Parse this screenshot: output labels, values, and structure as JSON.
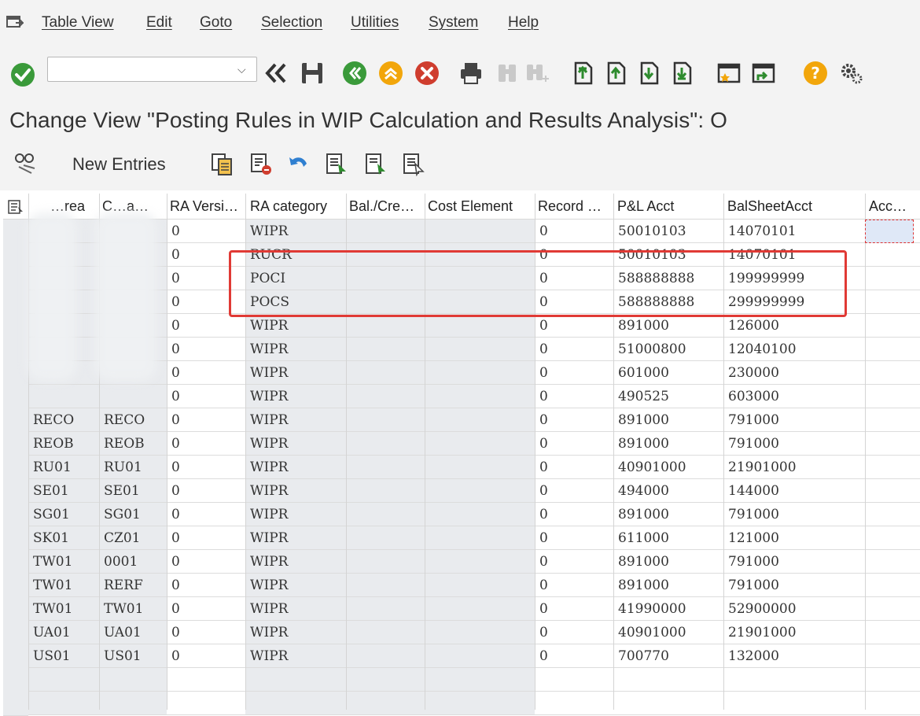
{
  "menu": {
    "items": [
      "Table View",
      "Edit",
      "Goto",
      "Selection",
      "Utilities",
      "System",
      "Help"
    ]
  },
  "toolbar": {
    "command_value": "",
    "icons": [
      "enter-icon",
      "back-double-icon",
      "save-icon",
      "back-icon",
      "exit-icon",
      "cancel-icon",
      "print-icon",
      "find-icon",
      "find-next-icon",
      "first-page-icon",
      "prev-page-icon",
      "next-page-icon",
      "last-page-icon",
      "create-session-icon",
      "shortcut-icon",
      "help-icon",
      "settings-icon"
    ]
  },
  "title": "Change View \"Posting Rules in WIP Calculation and Results Analysis\": O",
  "app_toolbar": {
    "new_entries_label": "New Entries",
    "icons": [
      "details-icon",
      "copy-icon",
      "delete-icon",
      "undo-icon",
      "select-all-icon",
      "select-block-icon",
      "deselect-all-icon"
    ]
  },
  "table": {
    "headers": [
      "",
      "…rea",
      "C…a…",
      "RA Versi…",
      "RA category",
      "Bal./Cre…",
      "Cost Element",
      "Record …",
      "P&L Acct",
      "BalSheetAcct",
      "Acc…"
    ],
    "rows": [
      [
        "",
        "",
        "0",
        "WIPR",
        "",
        "",
        "0",
        "50010103",
        "14070101"
      ],
      [
        "",
        "",
        "0",
        "RUCR",
        "",
        "",
        "0",
        "50010103",
        "14070101"
      ],
      [
        "",
        "",
        "0",
        "POCI",
        "",
        "",
        "0",
        "588888888",
        "199999999"
      ],
      [
        "",
        "",
        "0",
        "POCS",
        "",
        "",
        "0",
        "588888888",
        "299999999"
      ],
      [
        "",
        "",
        "0",
        "WIPR",
        "",
        "",
        "0",
        "891000",
        "126000"
      ],
      [
        "",
        "",
        "0",
        "WIPR",
        "",
        "",
        "0",
        "51000800",
        "12040100"
      ],
      [
        "",
        "",
        "0",
        "WIPR",
        "",
        "",
        "0",
        "601000",
        "230000"
      ],
      [
        "",
        "",
        "0",
        "WIPR",
        "",
        "",
        "0",
        "490525",
        "603000"
      ],
      [
        "RECO",
        "RECO",
        "0",
        "WIPR",
        "",
        "",
        "0",
        "891000",
        "791000"
      ],
      [
        "REOB",
        "REOB",
        "0",
        "WIPR",
        "",
        "",
        "0",
        "891000",
        "791000"
      ],
      [
        "RU01",
        "RU01",
        "0",
        "WIPR",
        "",
        "",
        "0",
        "40901000",
        "21901000"
      ],
      [
        "SE01",
        "SE01",
        "0",
        "WIPR",
        "",
        "",
        "0",
        "494000",
        "144000"
      ],
      [
        "SG01",
        "SG01",
        "0",
        "WIPR",
        "",
        "",
        "0",
        "891000",
        "791000"
      ],
      [
        "SK01",
        "CZ01",
        "0",
        "WIPR",
        "",
        "",
        "0",
        "611000",
        "121000"
      ],
      [
        "TW01",
        "0001",
        "0",
        "WIPR",
        "",
        "",
        "0",
        "891000",
        "791000"
      ],
      [
        "TW01",
        "RERF",
        "0",
        "WIPR",
        "",
        "",
        "0",
        "891000",
        "791000"
      ],
      [
        "TW01",
        "TW01",
        "0",
        "WIPR",
        "",
        "",
        "0",
        "41990000",
        "52900000"
      ],
      [
        "UA01",
        "UA01",
        "0",
        "WIPR",
        "",
        "",
        "0",
        "40901000",
        "21901000"
      ],
      [
        "US01",
        "US01",
        "0",
        "WIPR",
        "",
        "",
        "0",
        "700770",
        "132000"
      ]
    ]
  },
  "colors": {
    "accent_green": "#3a9a3a",
    "accent_orange": "#f2a60b",
    "accent_red": "#cf3d2e",
    "highlight_box": "#e03a35"
  }
}
